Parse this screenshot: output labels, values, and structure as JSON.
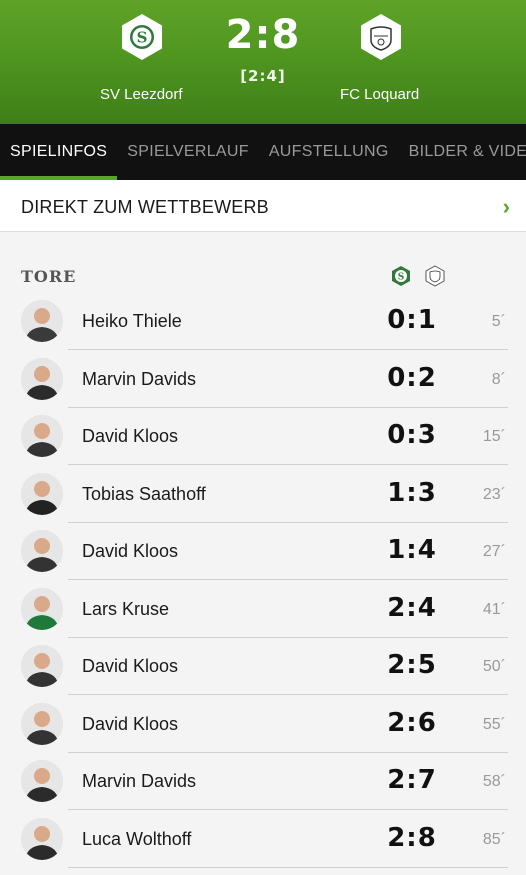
{
  "match": {
    "home_team": "SV Leezdorf",
    "away_team": "FC  Loquard",
    "score": "2:8",
    "halftime": "[2:4]"
  },
  "tabs": [
    {
      "label": "SPIELINFOS",
      "active": true
    },
    {
      "label": "SPIELVERLAUF",
      "active": false
    },
    {
      "label": "AUFSTELLUNG",
      "active": false
    },
    {
      "label": "BILDER & VIDEOS",
      "active": false
    }
  ],
  "competition_link": {
    "label": "DIREKT ZUM WETTBEWERB",
    "chevron": "›"
  },
  "goals": {
    "title": "TORE",
    "items": [
      {
        "player": "Heiko Thiele",
        "score": "0:1",
        "minute": "5´"
      },
      {
        "player": "Marvin Davids",
        "score": "0:2",
        "minute": "8´"
      },
      {
        "player": "David Kloos",
        "score": "0:3",
        "minute": "15´"
      },
      {
        "player": "Tobias Saathoff",
        "score": "1:3",
        "minute": "23´"
      },
      {
        "player": "David Kloos",
        "score": "1:4",
        "minute": "27´"
      },
      {
        "player": "Lars Kruse",
        "score": "2:4",
        "minute": "41´"
      },
      {
        "player": "David Kloos",
        "score": "2:5",
        "minute": "50´"
      },
      {
        "player": "David Kloos",
        "score": "2:6",
        "minute": "55´"
      },
      {
        "player": "Marvin Davids",
        "score": "2:7",
        "minute": "58´"
      },
      {
        "player": "Luca Wolthoff",
        "score": "2:8",
        "minute": "85´"
      }
    ]
  },
  "colors": {
    "header_green": "#4f9620",
    "accent_green": "#5aa62a",
    "tab_bar": "#111111"
  }
}
